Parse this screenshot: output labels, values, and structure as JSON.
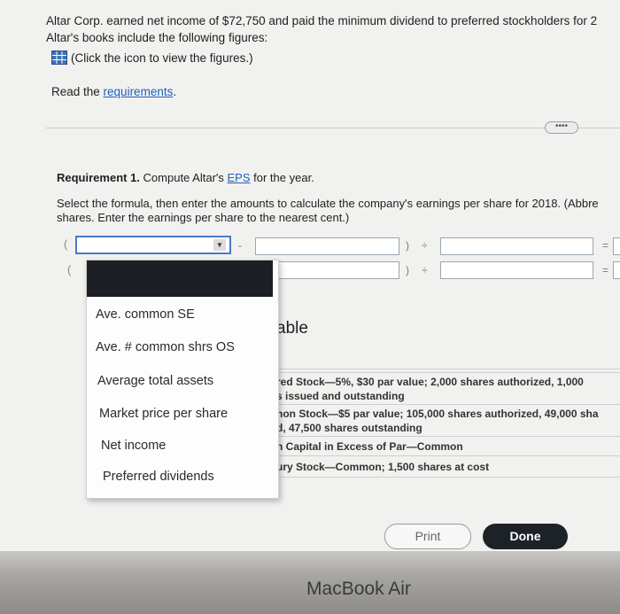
{
  "intro": {
    "line1": "Altar Corp. earned net income of $72,750 and paid the minimum dividend to preferred stockholders for 2",
    "line2": "Altar's books include the following figures:",
    "icon_link": "(Click the icon to view the figures.)",
    "read_prefix": "Read the ",
    "requirements_link": "requirements",
    "read_suffix": "."
  },
  "more_button": "••••",
  "requirement": {
    "bold": "Requirement 1.",
    "text_prefix": " Compute Altar's ",
    "eps_link": "EPS",
    "text_suffix": " for the year.",
    "instructions1": "Select the formula, then enter the amounts to calculate the company's earnings per share for 2018. (Abbre",
    "instructions2": "shares. Enter the earnings per share to the nearest cent.)"
  },
  "formula": {
    "open_paren": "(",
    "minus": "-",
    "close_paren": ")",
    "divide": "÷",
    "equals": "="
  },
  "dropdown": {
    "selected": "",
    "options": [
      "Ave. common SE",
      "Ave. # common shrs OS",
      "Average total assets",
      "Market price per share",
      "Net income",
      "Preferred dividends"
    ]
  },
  "popup": {
    "title_visible": "able",
    "rows": [
      "red Stock—5%, $30 par value; 2,000 shares authorized, 1,000",
      "s issued and outstanding",
      "non Stock—$5 par value; 105,000 shares authorized, 49,000 sha",
      "d, 47,500 shares outstanding",
      "n Capital in Excess of Par—Common",
      "ury Stock—Common; 1,500 shares at cost"
    ],
    "print_label": "Print",
    "done_label": "Done"
  },
  "device": {
    "brand": "MacBook Air"
  }
}
